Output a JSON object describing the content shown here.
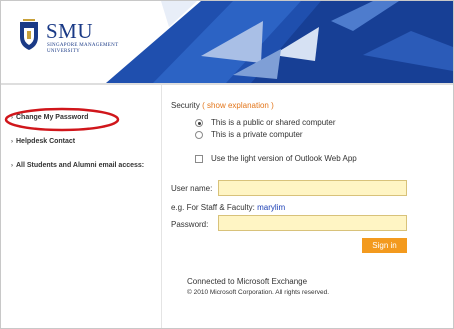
{
  "brand": {
    "name": "SMU",
    "subtitle_line1": "SINGAPORE MANAGEMENT",
    "subtitle_line2": "UNIVERSITY"
  },
  "sidebar": {
    "items": [
      {
        "label": "Change My Password",
        "highlighted": true
      },
      {
        "label": "Helpdesk Contact"
      },
      {
        "label": "All Students and Alumni email access:"
      }
    ]
  },
  "security": {
    "label": "Security",
    "paren_open": "(",
    "link": "show explanation",
    "paren_close": ")",
    "options": [
      {
        "label": "This is a public or shared computer",
        "selected": true
      },
      {
        "label": "This is a private computer",
        "selected": false
      }
    ],
    "light_version_label": "Use the light version of Outlook Web App",
    "light_version_checked": false
  },
  "login": {
    "username_label": "User name:",
    "username_value": "",
    "example_prefix": "e.g. For Staff & Faculty:",
    "example_value": "marylim",
    "password_label": "Password:",
    "password_value": "",
    "signin_label": "Sign in"
  },
  "footer": {
    "connected": "Connected to Microsoft Exchange",
    "copyright": "© 2010 Microsoft Corporation. All rights reserved."
  },
  "colors": {
    "brand_blue": "#1a3a86",
    "banner_blue": "#1f4fae",
    "accent_orange": "#e3761b",
    "button_orange": "#f39a1e",
    "field_fill": "#fff5c4",
    "highlight_red": "#d0161b"
  },
  "icons": {
    "logo": "smu-crest-icon",
    "chevron": "chevron-right-icon"
  }
}
